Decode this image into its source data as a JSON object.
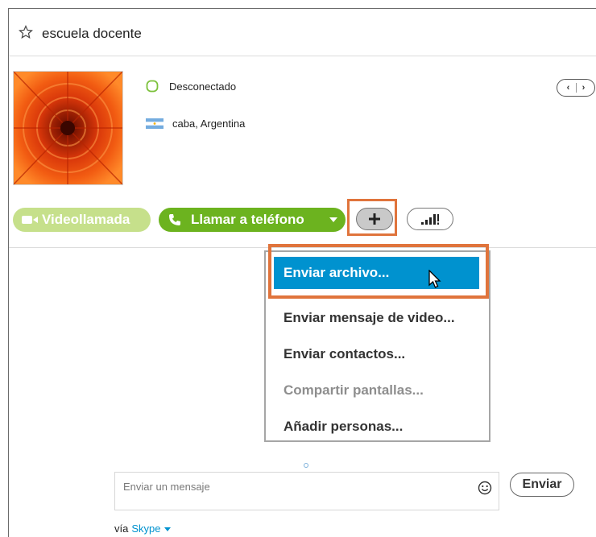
{
  "header": {
    "contact_name": "escuela docente"
  },
  "profile": {
    "status": "Desconectado",
    "location": "caba, Argentina"
  },
  "actions": {
    "video_call": "Videollamada",
    "call_phone": "Llamar a teléfono"
  },
  "menu": {
    "items": [
      {
        "label": "Enviar archivo...",
        "selected": true,
        "enabled": true
      },
      {
        "label": "Enviar mensaje de video...",
        "enabled": true
      },
      {
        "label": "Enviar contactos...",
        "enabled": true
      },
      {
        "label": "Compartir pantallas...",
        "enabled": false
      },
      {
        "label": "Añadir personas...",
        "enabled": true
      }
    ]
  },
  "composer": {
    "placeholder": "Enviar un mensaje",
    "send_label": "Enviar",
    "via_prefix": "vía",
    "via_link": "Skype"
  },
  "colors": {
    "accent": "#0092cf",
    "call_green": "#6cb31f",
    "video_green_disabled": "#c6e08b",
    "highlight_orange": "#e0743c"
  }
}
